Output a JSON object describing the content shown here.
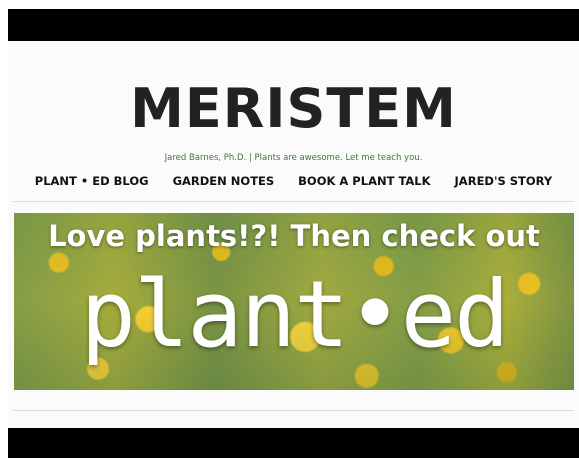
{
  "site": {
    "title": "MERISTEM",
    "tagline": "Jared Barnes, Ph.D. | Plants are awesome. Let me teach you."
  },
  "nav": {
    "items": [
      {
        "label": "PLANT • ED BLOG"
      },
      {
        "label": "GARDEN NOTES"
      },
      {
        "label": "BOOK A PLANT TALK"
      },
      {
        "label": "JARED'S STORY"
      }
    ]
  },
  "banner": {
    "headline": "Love plants!?! Then check out",
    "brand": "plant•ed"
  },
  "colors": {
    "tagline": "#3c7a3a",
    "logo": "#222222",
    "letterbox": "#000000"
  }
}
